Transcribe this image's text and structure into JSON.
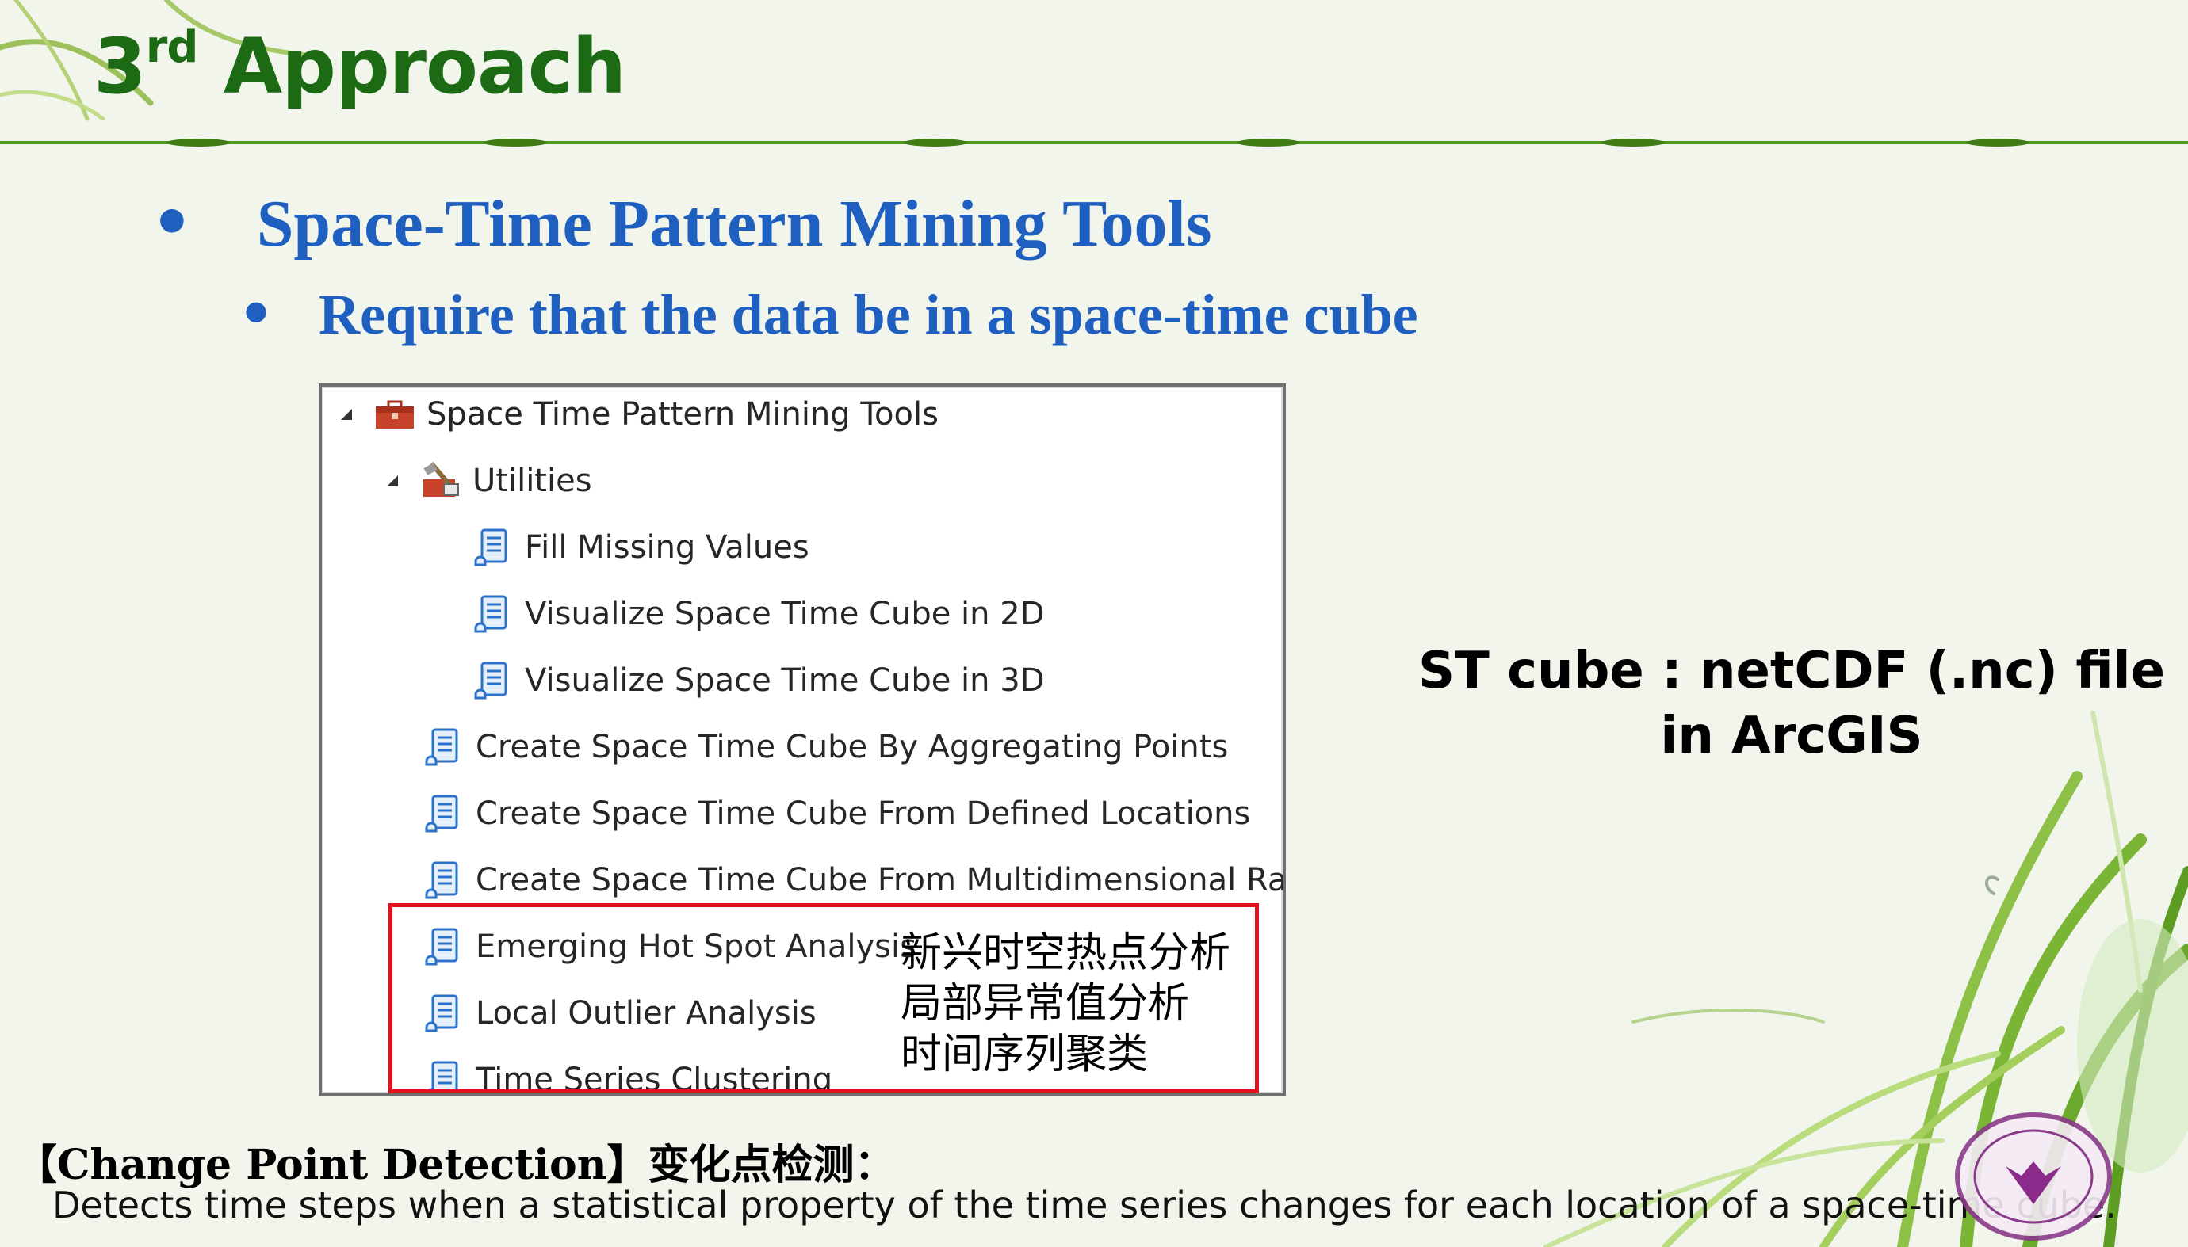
{
  "slide": {
    "title_main": "3",
    "title_sup": "rd",
    "title_rest": " Approach",
    "bullet_symbol": "•",
    "bullet1": "Space-Time Pattern Mining Tools",
    "bullet2": "Require that the data be in a space-time cube"
  },
  "tree": {
    "root": "Space Time Pattern Mining Tools",
    "utilities": "Utilities",
    "items": [
      "Fill Missing Values",
      "Visualize Space Time Cube in 2D",
      "Visualize Space Time Cube in 3D",
      "Create Space Time Cube By Aggregating Points",
      "Create Space Time Cube From Defined Locations",
      "Create Space Time Cube From Multidimensional Raste",
      "Emerging Hot Spot Analysis",
      "Local Outlier Analysis",
      "Time Series Clustering"
    ]
  },
  "chinese_labels": [
    "新兴时空热点分析",
    "局部异常值分析",
    "时间序列聚类"
  ],
  "st_cube_note": [
    "ST cube : netCDF (.nc) file",
    "in ArcGIS"
  ],
  "change_point": {
    "title": "【Change Point Detection】变化点检测：",
    "description": "Detects time steps when a statistical property of the time series changes for each location of a space-time cube."
  },
  "colors": {
    "title": "#1c6b14",
    "bullet": "#1f5fbf",
    "highlight_box": "#e0121b",
    "background": "#f1f5ec"
  }
}
